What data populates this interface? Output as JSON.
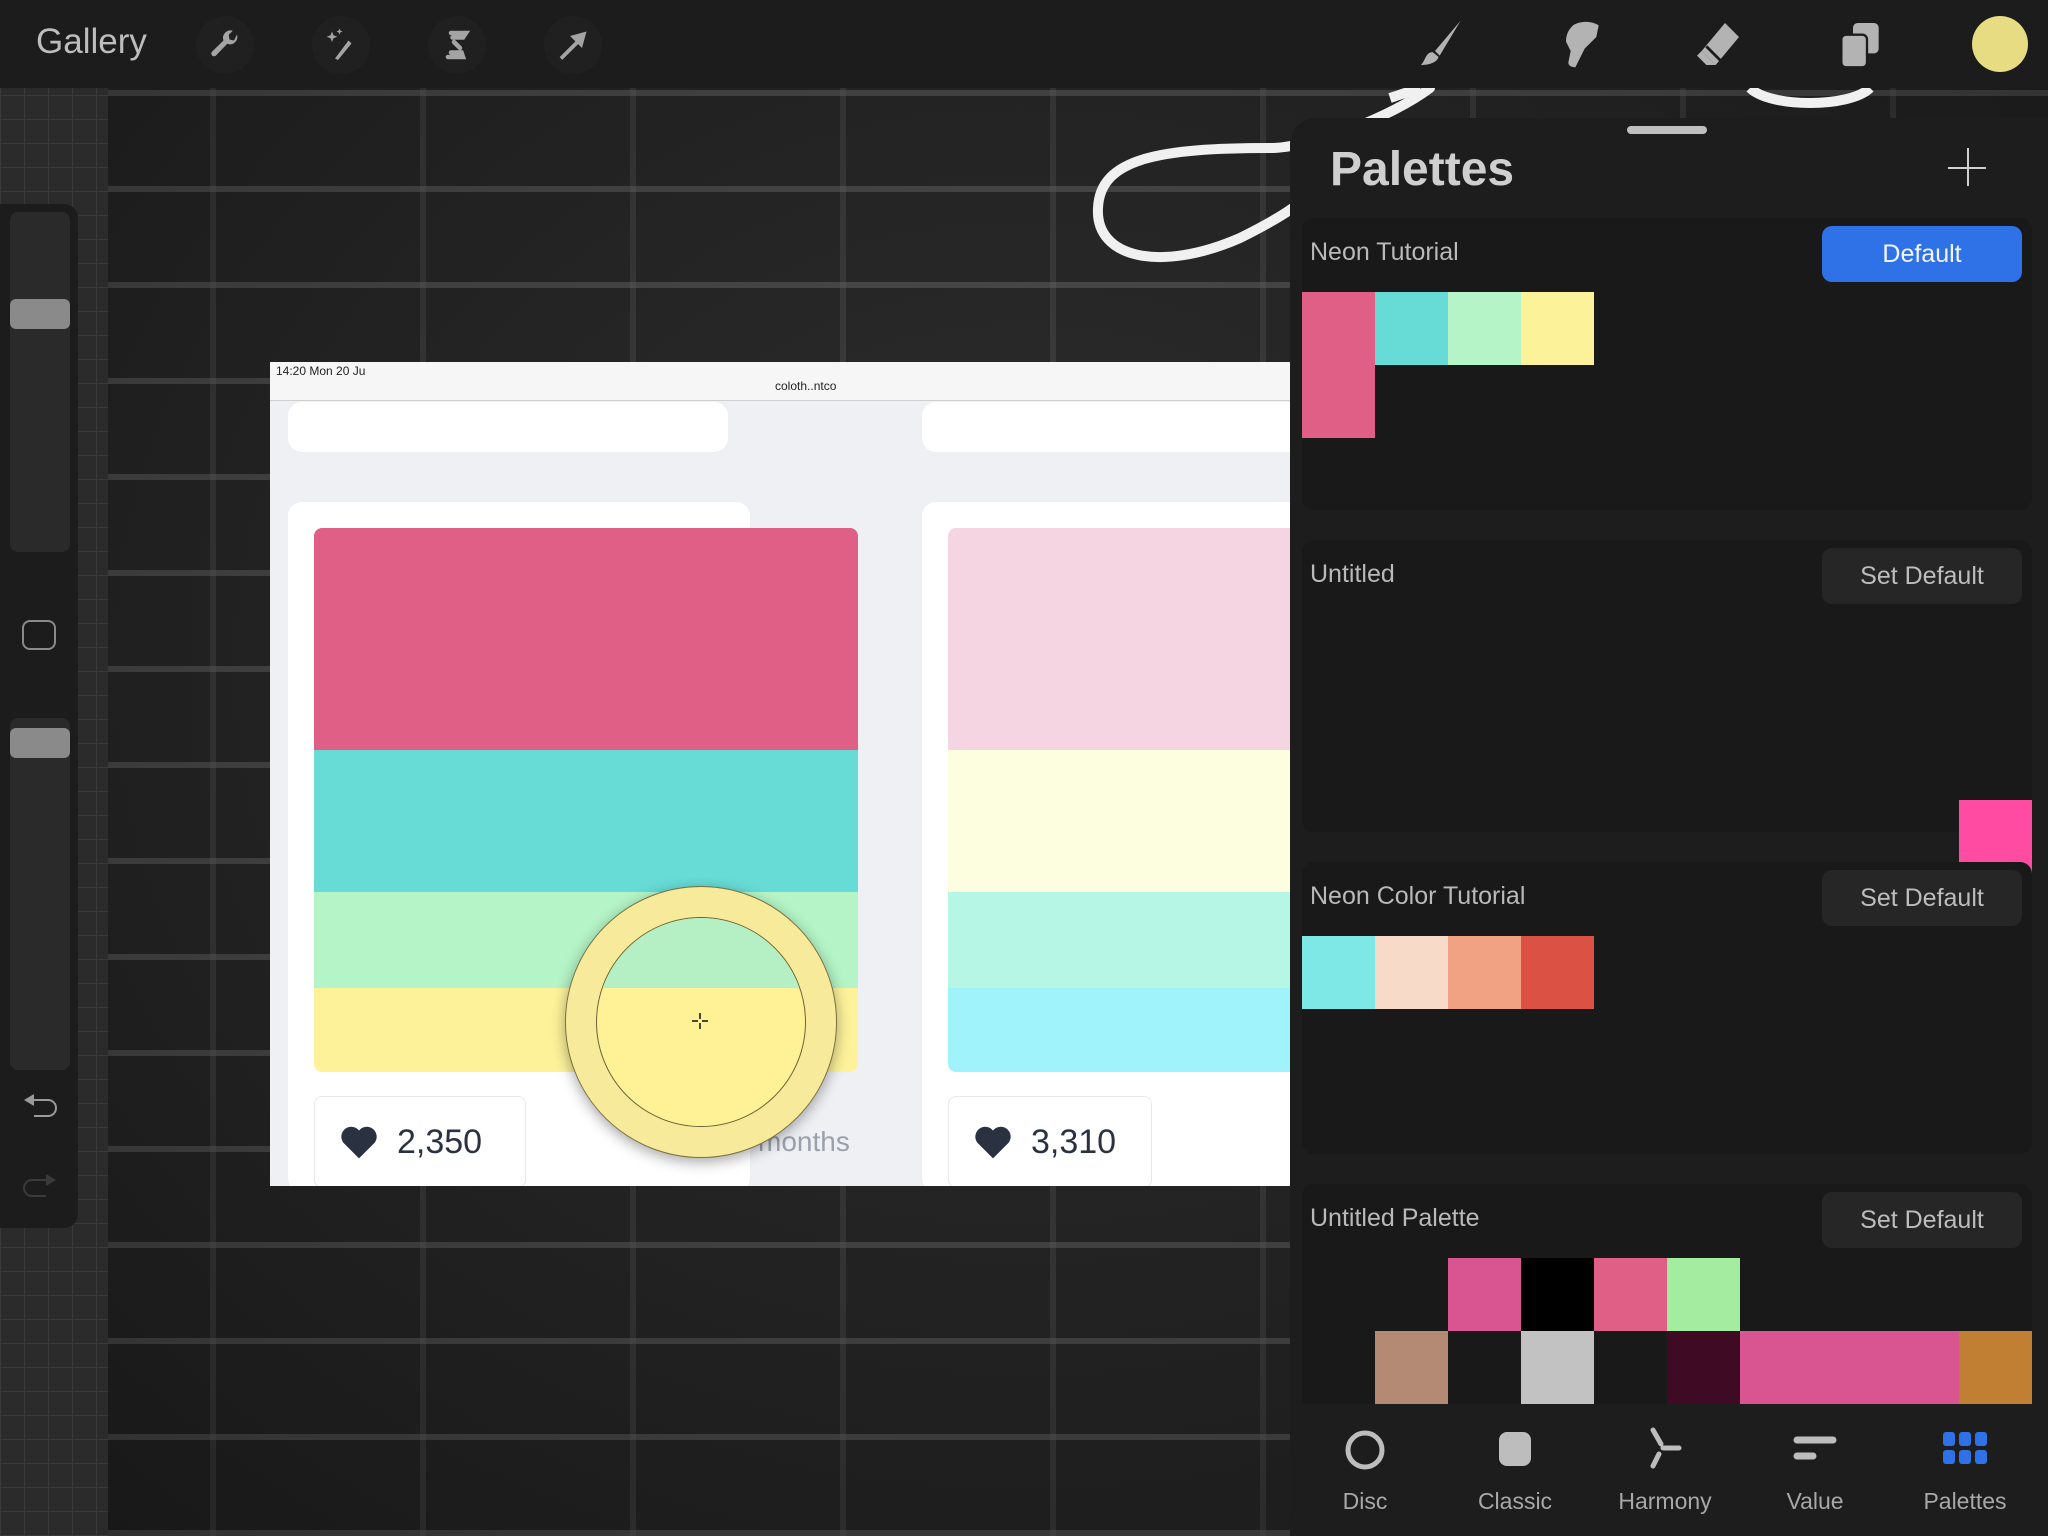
{
  "topbar": {
    "gallery_label": "Gallery",
    "left_tools": [
      "wrench-icon",
      "magic-wand-icon",
      "selection-icon",
      "transform-arrow-icon"
    ],
    "right_tools": [
      "brush-icon",
      "smudge-icon",
      "eraser-icon",
      "layers-icon"
    ],
    "current_color": "#e7dc82"
  },
  "sidebar": {
    "brush_size_level": 0.72,
    "opacity_level": 0.97,
    "undo_icon": "undo-arrow-icon",
    "redo_icon": "redo-arrow-icon"
  },
  "canvas_screenshot": {
    "status_time": "14:20  Mon 20 Ju",
    "url": "coloth..ntco",
    "card1": {
      "colors": [
        "#e05f87",
        "#67dbd6",
        "#b4f4c6",
        "#fdf29a"
      ],
      "likes": "2,350",
      "age_text": "months"
    },
    "card2": {
      "colors": [
        "#f5d5e2",
        "#fdfde0",
        "#b6f6e4",
        "#a0f3fb"
      ],
      "likes": "3,310"
    }
  },
  "color_loupe": {
    "color": "#fff196"
  },
  "palettes_panel": {
    "title": "Palettes",
    "add_icon": "plus-icon",
    "palettes": [
      {
        "name": "Neon Tutorial",
        "button": "Default",
        "is_default": true,
        "cells": [
          {
            "i": 0,
            "color": "#e05f87"
          },
          {
            "i": 1,
            "color": "#67dbd6"
          },
          {
            "i": 2,
            "color": "#b4f4c6"
          },
          {
            "i": 3,
            "color": "#fbf29a"
          },
          {
            "i": 10,
            "color": "#e05f87"
          }
        ]
      },
      {
        "name": "Untitled",
        "button": "Set Default",
        "is_default": false,
        "cells": [
          {
            "i": 29,
            "color": "#ff4ba1"
          }
        ]
      },
      {
        "name": "Neon Color Tutorial",
        "button": "Set Default",
        "is_default": false,
        "cells": [
          {
            "i": 0,
            "color": "#7ee8e6"
          },
          {
            "i": 1,
            "color": "#f7dbc8"
          },
          {
            "i": 2,
            "color": "#f0a283"
          },
          {
            "i": 3,
            "color": "#db5144"
          }
        ]
      },
      {
        "name": "Untitled Palette",
        "button": "Set Default",
        "is_default": false,
        "cells": [
          {
            "i": 2,
            "color": "#d95592"
          },
          {
            "i": 3,
            "color": "#000000"
          },
          {
            "i": 4,
            "color": "#e05f87"
          },
          {
            "i": 5,
            "color": "#a3eca0"
          },
          {
            "i": 11,
            "color": "#b58a74"
          },
          {
            "i": 13,
            "color": "#c2c2c2"
          },
          {
            "i": 15,
            "color": "#3f0a24"
          },
          {
            "i": 16,
            "color": "#d95592"
          },
          {
            "i": 17,
            "color": "#d95592"
          },
          {
            "i": 18,
            "color": "#d95592"
          },
          {
            "i": 19,
            "color": "#c17f33"
          }
        ]
      }
    ]
  },
  "color_tabs": [
    {
      "label": "Disc",
      "icon": "disc-icon",
      "active": false
    },
    {
      "label": "Classic",
      "icon": "classic-square-icon",
      "active": false
    },
    {
      "label": "Harmony",
      "icon": "harmony-icon",
      "active": false
    },
    {
      "label": "Value",
      "icon": "value-sliders-icon",
      "active": false
    },
    {
      "label": "Palettes",
      "icon": "palettes-grid-icon",
      "active": true
    }
  ],
  "accent_color": "#2f72e8"
}
